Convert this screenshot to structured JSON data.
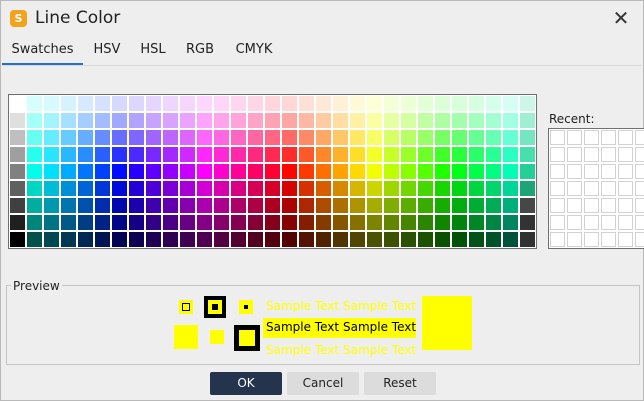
{
  "dialog": {
    "title": "Line Color",
    "app_icon_glyph": "S",
    "close_glyph": "✕"
  },
  "tabs": [
    {
      "label": "Swatches",
      "active": true
    },
    {
      "label": "HSV",
      "active": false
    },
    {
      "label": "HSL",
      "active": false
    },
    {
      "label": "RGB",
      "active": false
    },
    {
      "label": "CMYK",
      "active": false
    }
  ],
  "recent": {
    "label": "Recent:"
  },
  "preview": {
    "label": "Preview",
    "sample_text": "Sample Text",
    "selected_color": "#ffff00",
    "text_colors": {
      "dark": "#000000"
    }
  },
  "buttons": {
    "ok": "OK",
    "cancel": "Cancel",
    "reset": "Reset"
  },
  "colors": {
    "accent": "#2372c7",
    "ok_button": "#23344c"
  }
}
